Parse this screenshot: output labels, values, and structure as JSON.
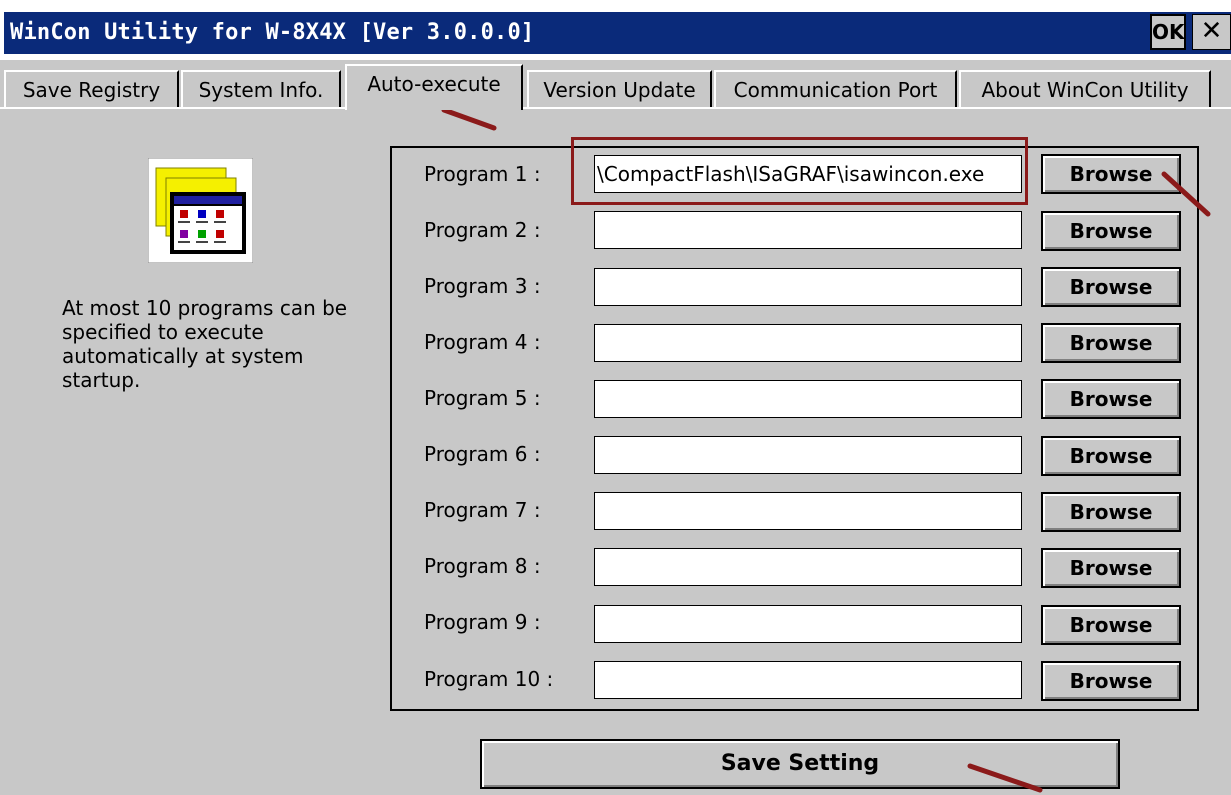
{
  "window": {
    "title": "WinCon Utility for W-8X4X [Ver 3.0.0.0]",
    "ok_label": "OK",
    "close_label": "✕"
  },
  "tabs": [
    {
      "label": "Save Registry"
    },
    {
      "label": "System Info."
    },
    {
      "label": "Auto-execute",
      "active": true
    },
    {
      "label": "Version Update"
    },
    {
      "label": "Communication Port"
    },
    {
      "label": "About WinCon Utility"
    }
  ],
  "sidebar": {
    "icon": "program-folder-icon",
    "description": "At most 10 programs can be specified to execute automatically at system startup."
  },
  "programs": [
    {
      "label": "Program 1 :",
      "value": "\\CompactFlash\\ISaGRAF\\isawincon.exe",
      "browse": "Browse"
    },
    {
      "label": "Program 2 :",
      "value": "",
      "browse": "Browse"
    },
    {
      "label": "Program 3 :",
      "value": "",
      "browse": "Browse"
    },
    {
      "label": "Program 4 :",
      "value": "",
      "browse": "Browse"
    },
    {
      "label": "Program 5 :",
      "value": "",
      "browse": "Browse"
    },
    {
      "label": "Program 6 :",
      "value": "",
      "browse": "Browse"
    },
    {
      "label": "Program 7 :",
      "value": "",
      "browse": "Browse"
    },
    {
      "label": "Program 8 :",
      "value": "",
      "browse": "Browse"
    },
    {
      "label": "Program 9 :",
      "value": "",
      "browse": "Browse"
    },
    {
      "label": "Program 10 :",
      "value": "",
      "browse": "Browse"
    }
  ],
  "save_button": "Save Setting",
  "colors": {
    "titlebar": "#0a2a7a",
    "background": "#c8c8c8",
    "annotation": "#8b1a1a"
  }
}
